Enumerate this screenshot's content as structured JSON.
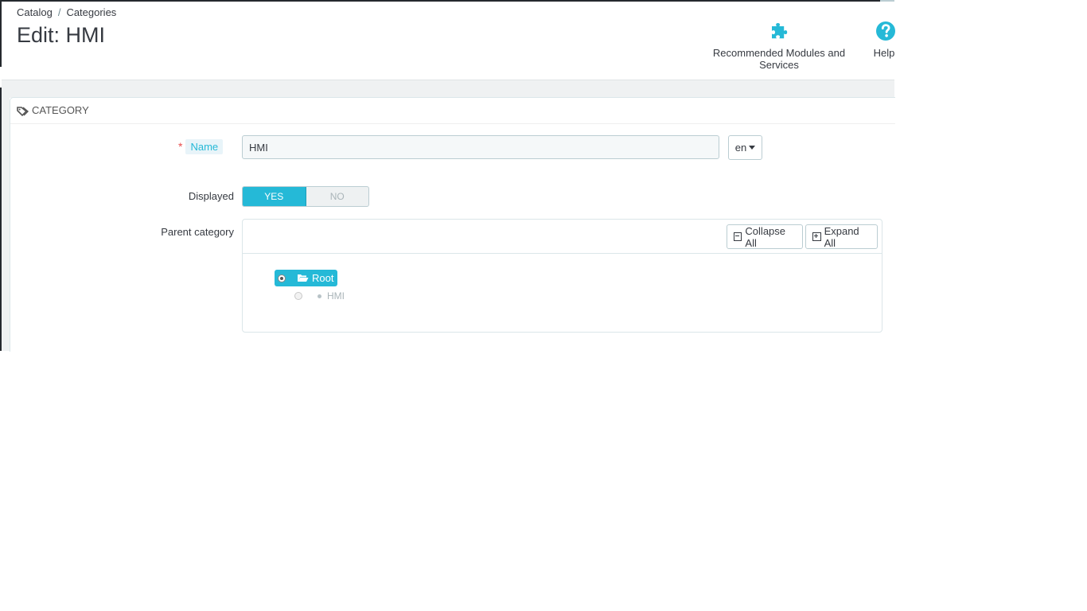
{
  "breadcrumb": {
    "items": [
      "Catalog",
      "Categories"
    ],
    "separator": "/"
  },
  "page": {
    "title": "Edit: HMI"
  },
  "toolbar": {
    "modules_label": "Recommended Modules and Services",
    "modules_icon": "puzzle-icon",
    "help_label": "Help",
    "help_icon": "question-circle-icon",
    "accent": "#25b9d7"
  },
  "panel": {
    "heading": "CATEGORY",
    "heading_icon": "tags-icon",
    "fields": {
      "name_label": "Name",
      "name_required": "*",
      "name_value": "HMI",
      "language": "en",
      "displayed_label": "Displayed",
      "displayed_yes": "YES",
      "displayed_no": "NO",
      "displayed_value": "YES",
      "parent_label": "Parent category"
    },
    "tree": {
      "collapse_label": "Collapse All",
      "expand_label": "Expand All",
      "root_label": "Root",
      "root_selected": true,
      "children": [
        "HMI"
      ]
    }
  }
}
